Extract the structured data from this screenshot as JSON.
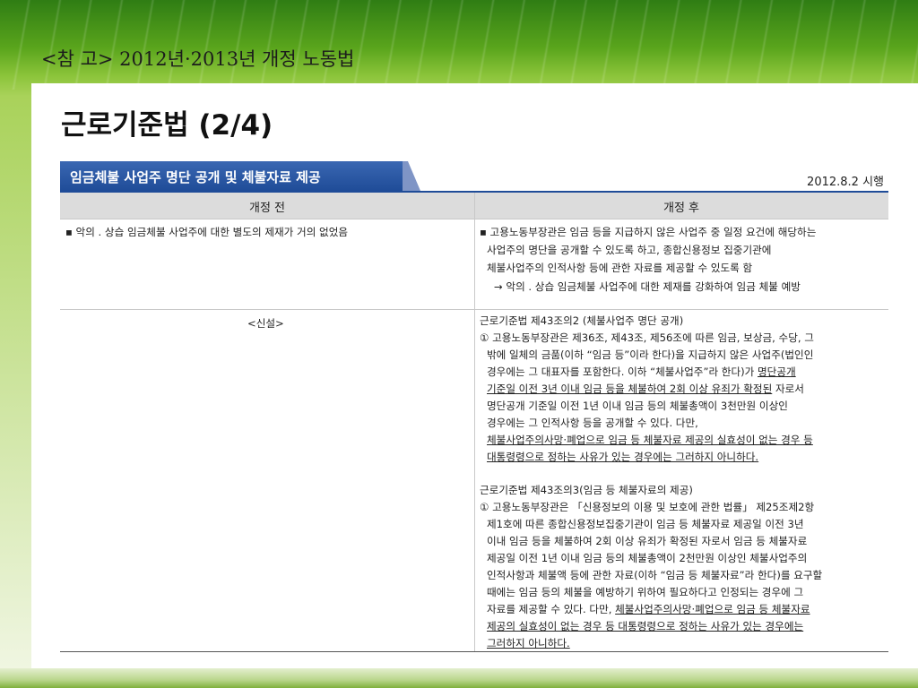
{
  "slide_title": "<참 고> 2012년·2013년 개정 노동법",
  "main_title": "근로기준법 (2/4)",
  "section_tab": "임금체불 사업주 명단 공개 및 체불자료 제공",
  "effective_date": "2012.8.2 시행",
  "columns": [
    "개정 전",
    "개정 후"
  ],
  "row1": {
    "before": "▪ 악의 . 상습 임금체불 사업주에 대한 별도의 제재가 거의 없었음",
    "after_lines": [
      "▪ 고용노동부장관은 임금 등을 지급하지 않은 사업주 중 일정 요건에 해당하는",
      "사업주의 명단을 공개할 수 있도록 하고, 종합신용정보 집중기관에",
      "체불사업주의 인적사항 등에 관한 자료를 제공할 수 있도록 함",
      "→ 악의 . 상습 임금체불 사업주에 대한 제재를 강화하여 임금 체불 예방"
    ]
  },
  "row2": {
    "before": "<신설>",
    "art1_title": "근로기준법 제43조의2 (체불사업주 명단 공개)",
    "art1_lines": [
      "① 고용노동부장관은 제36조, 제43조, 제56조에 따른 임금, 보상금, 수당, 그",
      "밖에 일체의 금품(이하 “임금 등”이라 한다)을 지급하지 않은 사업주(법인인",
      "경우에는 그 대표자를 포함한다. 이하 “체불사업주”라 한다)가 ",
      "명단공개",
      "기준일 이전 3년 이내 임금 등을 체불하여 2회 이상 유죄가 확정된",
      " 자로서",
      "명단공개 기준일 이전 1년 이내 임금 등의 체불총액이 3천만원 이상인",
      "경우에는 그 인적사항 등을 공개할 수 있다. 다만,",
      "체불사업주의사망·폐업으로 임금 등 체불자료 제공의 실효성이 없는 경우 등",
      "대통령령으로 정하는 사유가 있는 경우에는 그러하지 아니하다."
    ],
    "art2_title": "근로기준법 제43조의3(임금 등 체불자료의 제공)",
    "art2_lines": [
      "① 고용노동부장관은 「신용정보의 이용 및 보호에 관한 법률」 제25조제2항",
      "제1호에 따른 종합신용정보집중기관이 임금 등 체불자료 제공일 이전 3년",
      "이내 임금 등을 체불하여 2회 이상 유죄가 확정된 자로서 임금 등 체불자료",
      "제공일 이전 1년 이내 임금 등의 체불총액이 2천만원 이상인 체불사업주의",
      "인적사항과 체불액 등에 관한 자료(이하 “임금 등 체불자료”라 한다)를 요구할",
      "때에는 임금 등의 체불을 예방하기 위하여 필요하다고 인정되는 경우에 그",
      "자료를 제공할 수 있다. 다만, ",
      "체불사업주의사망·폐업으로 임금 등 체불자료",
      "제공의 실효성이 없는 경우 등 대통령령으로 정하는 사유가 있는 경우에는",
      "그러하지 아니하다."
    ]
  }
}
